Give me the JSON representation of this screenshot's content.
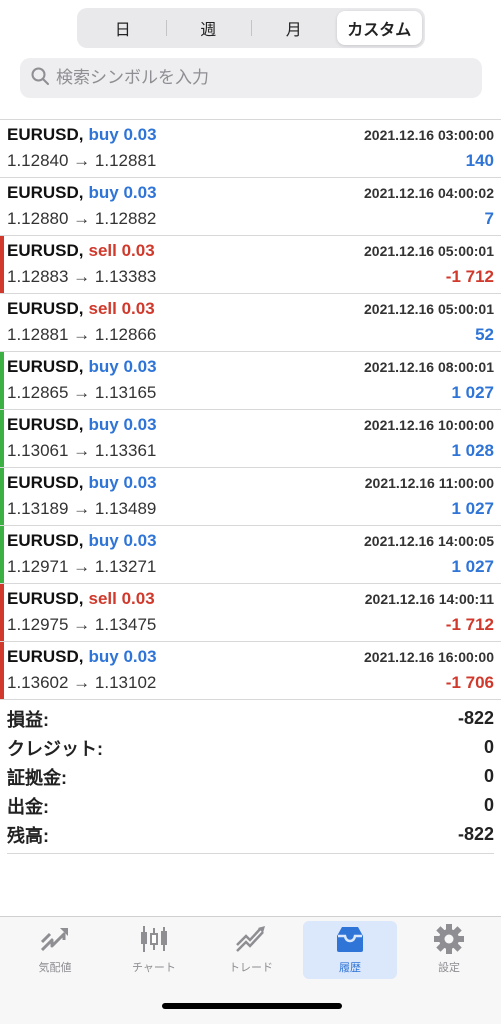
{
  "segments": [
    "日",
    "週",
    "月",
    "カスタム"
  ],
  "active_segment": 3,
  "search": {
    "placeholder": "検索シンボルを入力"
  },
  "trades": [
    {
      "symbol": "EURUSD,",
      "side": "buy 0.03",
      "direction": "buy",
      "time": "2021.12.16 03:00:00",
      "prices": "1.12840 → 1.12881",
      "profit": "140",
      "profit_sign": "pos",
      "marker": ""
    },
    {
      "symbol": "EURUSD,",
      "side": "buy 0.03",
      "direction": "buy",
      "time": "2021.12.16 04:00:02",
      "prices": "1.12880 → 1.12882",
      "profit": "7",
      "profit_sign": "pos",
      "marker": ""
    },
    {
      "symbol": "EURUSD,",
      "side": "sell 0.03",
      "direction": "sell",
      "time": "2021.12.16 05:00:01",
      "prices": "1.12883 → 1.13383",
      "profit": "-1 712",
      "profit_sign": "neg",
      "marker": "#d0392b"
    },
    {
      "symbol": "EURUSD,",
      "side": "sell 0.03",
      "direction": "sell",
      "time": "2021.12.16 05:00:01",
      "prices": "1.12881 → 1.12866",
      "profit": "52",
      "profit_sign": "pos",
      "marker": ""
    },
    {
      "symbol": "EURUSD,",
      "side": "buy 0.03",
      "direction": "buy",
      "time": "2021.12.16 08:00:01",
      "prices": "1.12865 → 1.13165",
      "profit": "1 027",
      "profit_sign": "pos",
      "marker": "#3cb043"
    },
    {
      "symbol": "EURUSD,",
      "side": "buy 0.03",
      "direction": "buy",
      "time": "2021.12.16 10:00:00",
      "prices": "1.13061 → 1.13361",
      "profit": "1 028",
      "profit_sign": "pos",
      "marker": "#3cb043"
    },
    {
      "symbol": "EURUSD,",
      "side": "buy 0.03",
      "direction": "buy",
      "time": "2021.12.16 11:00:00",
      "prices": "1.13189 → 1.13489",
      "profit": "1 027",
      "profit_sign": "pos",
      "marker": "#3cb043"
    },
    {
      "symbol": "EURUSD,",
      "side": "buy 0.03",
      "direction": "buy",
      "time": "2021.12.16 14:00:05",
      "prices": "1.12971 → 1.13271",
      "profit": "1 027",
      "profit_sign": "pos",
      "marker": "#3cb043"
    },
    {
      "symbol": "EURUSD,",
      "side": "sell 0.03",
      "direction": "sell",
      "time": "2021.12.16 14:00:11",
      "prices": "1.12975 → 1.13475",
      "profit": "-1 712",
      "profit_sign": "neg",
      "marker": "#d0392b"
    },
    {
      "symbol": "EURUSD,",
      "side": "buy 0.03",
      "direction": "buy",
      "time": "2021.12.16 16:00:00",
      "prices": "1.13602 → 1.13102",
      "profit": "-1 706",
      "profit_sign": "neg",
      "marker": "#d0392b"
    }
  ],
  "summary": [
    {
      "label": "損益:",
      "value": "-822"
    },
    {
      "label": "クレジット:",
      "value": "0"
    },
    {
      "label": "証拠金:",
      "value": "0"
    },
    {
      "label": "出金:",
      "value": "0"
    },
    {
      "label": "残高:",
      "value": "-822"
    }
  ],
  "tabs": [
    {
      "label": "気配値",
      "icon": "quotes-icon"
    },
    {
      "label": "チャート",
      "icon": "chart-icon"
    },
    {
      "label": "トレード",
      "icon": "trade-icon"
    },
    {
      "label": "履歴",
      "icon": "history-inbox-icon"
    },
    {
      "label": "設定",
      "icon": "settings-gear-icon"
    }
  ],
  "active_tab": 3,
  "colors": {
    "buy": "#2f74d7",
    "sell": "#d0392b",
    "win_marker": "#3cb043",
    "loss_marker": "#d0392b",
    "accent": "#2f74d7"
  }
}
